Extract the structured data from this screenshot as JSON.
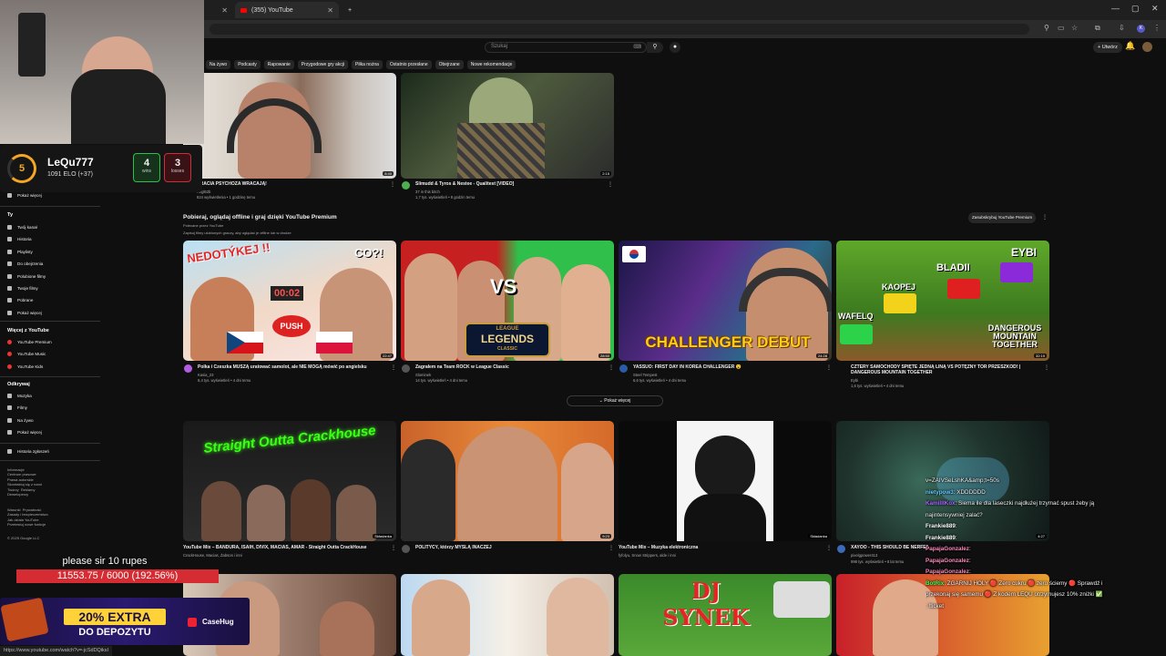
{
  "browser": {
    "tabs": [
      {
        "label": ""
      },
      {
        "label": "(355) YouTube"
      }
    ],
    "new_tab": "+"
  },
  "youtube": {
    "search_placeholder": "Szukaj",
    "create_label": "+ Utwórz",
    "chips": [
      "Na żywo",
      "Podcasty",
      "Rapowanie",
      "Przygodowe gry akcji",
      "Piłka nożna",
      "Ostatnio przesłane",
      "Obejrzane",
      "Nowe rekomendacje"
    ],
    "sidebar": {
      "show_more_1": "Pokaż więcej",
      "you_head": "Ty",
      "you_items": [
        "Twój kanał",
        "Historia",
        "Playlisty",
        "Do obejrzenia",
        "Polubione filmy",
        "Twoje filmy",
        "Pobrane",
        "Pokaż więcej"
      ],
      "more_head": "Więcej z YouTube",
      "more_items": [
        "YouTube Premium",
        "YouTube Music",
        "YouTube Kids"
      ],
      "explore_head": "Odkrywaj",
      "explore_items": [
        "Muzyka",
        "Filmy",
        "Na żywo",
        "Pokaż więcej"
      ],
      "report_item": "Historia zgłoszeń",
      "footer1": "Informacje\nCentrum prasowe\nPrawa autorskie\nSkontaktuj się z nami\nTwórcy  Reklamy\nDeweloperzy",
      "footer2": "Warunki  Prywatność\nZasady i bezpieczeństwo\nJak działa YouTube\nPrzetestuj nowe funkcje",
      "copyright": "© 2025 Google LLC"
    },
    "top_videos": [
      {
        "title": "BRACIA PSYCHOZA WRACAJĄ!",
        "channel": "Angl62b",
        "meta": "824 wyświetlenia • 1 godzinę temu",
        "duration": "8:40"
      },
      {
        "title": "Slimudd & Tyros & Nestee - Qualitest [VIDEO]",
        "channel": "37 in this bitch",
        "meta": "1,7 tys. wyświetleń • 8 godzin temu",
        "duration": "2:15"
      }
    ],
    "premium": {
      "title": "Pobieraj, oglądaj offline i graj dzięki YouTube Premium",
      "sub1": "Polecane przez YouTube",
      "sub2": "Zapisuj filmy ulubionych graczy, aby oglądać je offline lub w drodze",
      "button": "Zasubskrybuj YouTube Premium",
      "videos": [
        {
          "title": "Polka i Czeszka MUSZĄ uratować samolot, ale NIE MOGĄ mówić po angielsku",
          "channel": "Kasia_23",
          "meta": "6,4 tys. wyświetleń • 4 dni temu",
          "duration": "22:47",
          "thumb_text": [
            "NEDOTÝKEJ !!",
            "CO?!",
            "00:02",
            "PUSH"
          ]
        },
        {
          "title": "Zagrałem na Team ROCK w League Classic",
          "channel": "Slominek",
          "meta": "14 tys. wyświetleń • 4 dni temu",
          "duration": "28:50",
          "thumb_text": [
            "VS",
            "LEAGUE",
            "LEGENDS",
            "CLASSIC"
          ]
        },
        {
          "title": "YASSUO: FIRST DAY IN KOREA CHALLENGER 😮",
          "channel": "Steel Tempest",
          "meta": "6,6 tys. wyświetleń • 4 dni temu",
          "duration": "24:28",
          "thumb_text": [
            "CHALLENGER DEBUT"
          ]
        },
        {
          "title": "CZTERY SAMOCHODY SPIĘTE JEDNĄ LINĄ VS POTĘŻNY TOR PRZESZKÓD! | DANGEROUS MOUNTAIN TOGETHER",
          "channel": "Eybi",
          "meta": "1,6 tys. wyświetleń • 4 dni temu",
          "duration": "32:19",
          "thumb_text": [
            "EYBI",
            "BLADII",
            "KAOPEJ",
            "WAFELQ",
            "DANGEROUS",
            "MOUNTAIN",
            "TOGETHER"
          ]
        }
      ],
      "show_more": "Pokaż więcej"
    },
    "bottom_videos": [
      {
        "title": "YouTube Mix – BANDURA, ISAIH, DIVIX, MACIAS, AMAR - Straight Outta CrackHouse",
        "meta": "CrackHouse, Macias, Żabson i inni",
        "badge": "Składanka",
        "thumb_text": "Straight Outta Crackhouse"
      },
      {
        "title": "POLITYCY, którzy MYŚLĄ INACZEJ",
        "meta": "",
        "duration": "9:23"
      },
      {
        "title": "YouTube Mix – Muzyka elektroniczna",
        "meta": "fyfolyu, Snow Strippers, alde i inni",
        "badge": "Składanka"
      },
      {
        "title": "XAYOO - THIS SHOULD BE NERFED",
        "channel": "pixelgpower413",
        "meta": "998 tys. wyświetleń • 8 lat temu",
        "duration": "4:27"
      }
    ],
    "row3_text": "DJ SYNEK"
  },
  "stream": {
    "elo": {
      "level": "5",
      "name": "LeQu777",
      "elo": "1091 ELO (+37)",
      "wins": "4",
      "wins_label": "wins",
      "losses": "3",
      "losses_label": "losses"
    },
    "chat": [
      {
        "user": "",
        "text": "v=ZAIVSeLshKA&amp;t=50s",
        "color": "#9ad1ff"
      },
      {
        "user": "nietypow3",
        "text": ": XDDDDDD",
        "color": "#6cf"
      },
      {
        "user": "KamilIIKox",
        "text": ": Siema ile dla laseczki najdłużej trzymać spust żeby ją",
        "color": "#a6f"
      },
      {
        "user": "",
        "text": "najintensywniej zalać?",
        "color": "#fff"
      },
      {
        "user": "Frankie889",
        "text": ":",
        "color": "#fff"
      },
      {
        "user": "Frankie889",
        "text": ":",
        "color": "#fff"
      },
      {
        "user": "PapajaGonzalez",
        "text": ":",
        "color": "#f8b"
      },
      {
        "user": "PapajaGonzalez",
        "text": ":",
        "color": "#f8b"
      },
      {
        "user": "PapajaGonzalez",
        "text": ":",
        "color": "#f8b"
      },
      {
        "user": "BotRix",
        "text": ": ZGARNIJ HOLY 🔴 Zero cukru 🔴 zero ściemy 🔴 Sprawdź i",
        "color": "#5f5"
      },
      {
        "user": "",
        "text": "przekonaj się samemu 🔴 Z kodem LEQU otrzymujesz 10% zniżki ✅",
        "color": "#fff"
      },
      {
        "user": "",
        "text": ": !ticket",
        "color": "#fff"
      }
    ],
    "goal": {
      "label": "please sir 10 rupes",
      "value": "11553.75 / 6000 (192.56%)",
      "progress": 1.0
    },
    "promo": {
      "line1": "20% EXTRA",
      "line2": "DO DEPOZYTU",
      "brand": "CaseHug"
    }
  },
  "statusbar": {
    "url": "https://www.youtube.com/watch?v=-jcSdDQiksI"
  },
  "colors": {
    "bg": "#0f0f0f",
    "accent_red": "#ff0033",
    "goal_red": "#d42c32",
    "elo_orange": "#f5a623",
    "wins_green": "#2fbf4a",
    "losses_red": "#c9303a"
  }
}
